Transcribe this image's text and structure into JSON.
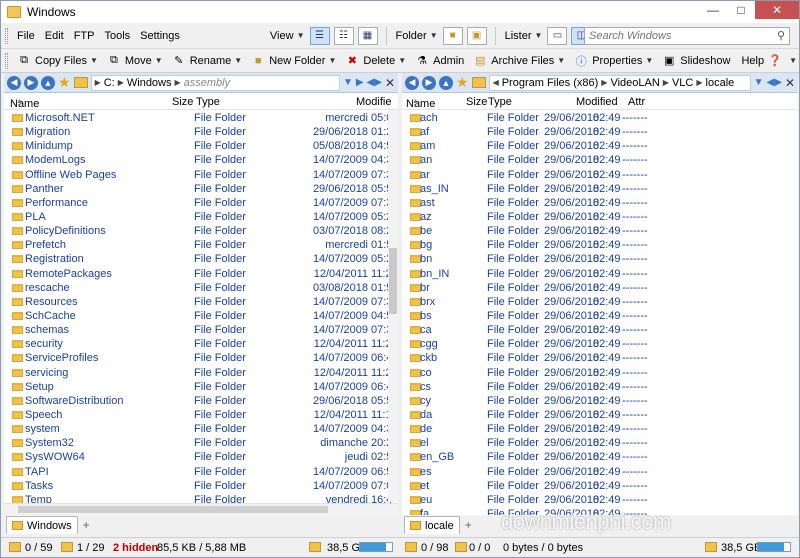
{
  "window": {
    "title": "Windows"
  },
  "menu": [
    "File",
    "Edit",
    "FTP",
    "Tools",
    "Settings"
  ],
  "view_bar": {
    "view_label": "View",
    "folder_label": "Folder",
    "lister_label": "Lister"
  },
  "search": {
    "placeholder": "Search Windows"
  },
  "toolbar": {
    "copy": "Copy Files",
    "move": "Move",
    "rename": "Rename",
    "new_folder": "New Folder",
    "delete": "Delete",
    "admin": "Admin",
    "archive": "Archive Files",
    "properties": "Properties",
    "slideshow": "Slideshow",
    "help": "Help"
  },
  "left": {
    "path": [
      "C:",
      "Windows",
      "assembly"
    ],
    "columns": {
      "name": "Name",
      "size": "Size",
      "type": "Type",
      "modified": "Modifie"
    },
    "rows": [
      {
        "name": "Microsoft.NET",
        "type": "File Folder",
        "date": "mercredi",
        "time": "05:0"
      },
      {
        "name": "Migration",
        "type": "File Folder",
        "date": "29/06/2018",
        "time": "01:2"
      },
      {
        "name": "Minidump",
        "type": "File Folder",
        "date": "05/08/2018",
        "time": "04:5"
      },
      {
        "name": "ModemLogs",
        "type": "File Folder",
        "date": "14/07/2009",
        "time": "04:3"
      },
      {
        "name": "Offline Web Pages",
        "type": "File Folder",
        "date": "14/07/2009",
        "time": "07:3"
      },
      {
        "name": "Panther",
        "type": "File Folder",
        "date": "29/06/2018",
        "time": "05:5"
      },
      {
        "name": "Performance",
        "type": "File Folder",
        "date": "14/07/2009",
        "time": "07:3"
      },
      {
        "name": "PLA",
        "type": "File Folder",
        "date": "14/07/2009",
        "time": "05:2"
      },
      {
        "name": "PolicyDefinitions",
        "type": "File Folder",
        "date": "03/07/2018",
        "time": "08:2"
      },
      {
        "name": "Prefetch",
        "type": "File Folder",
        "date": "mercredi",
        "time": "01:5"
      },
      {
        "name": "Registration",
        "type": "File Folder",
        "date": "14/07/2009",
        "time": "05:2"
      },
      {
        "name": "RemotePackages",
        "type": "File Folder",
        "date": "12/04/2011",
        "time": "11:2"
      },
      {
        "name": "rescache",
        "type": "File Folder",
        "date": "03/08/2018",
        "time": "01:5"
      },
      {
        "name": "Resources",
        "type": "File Folder",
        "date": "14/07/2009",
        "time": "07:3"
      },
      {
        "name": "SchCache",
        "type": "File Folder",
        "date": "14/07/2009",
        "time": "04:5"
      },
      {
        "name": "schemas",
        "type": "File Folder",
        "date": "14/07/2009",
        "time": "07:3"
      },
      {
        "name": "security",
        "type": "File Folder",
        "date": "12/04/2011",
        "time": "11:2"
      },
      {
        "name": "ServiceProfiles",
        "type": "File Folder",
        "date": "14/07/2009",
        "time": "06:4"
      },
      {
        "name": "servicing",
        "type": "File Folder",
        "date": "12/04/2011",
        "time": "11:2"
      },
      {
        "name": "Setup",
        "type": "File Folder",
        "date": "14/07/2009",
        "time": "06:4"
      },
      {
        "name": "SoftwareDistribution",
        "type": "File Folder",
        "date": "29/06/2018",
        "time": "05:5"
      },
      {
        "name": "Speech",
        "type": "File Folder",
        "date": "12/04/2011",
        "time": "11:1"
      },
      {
        "name": "system",
        "type": "File Folder",
        "date": "14/07/2009",
        "time": "04:3"
      },
      {
        "name": "System32",
        "type": "File Folder",
        "date": "dimanche",
        "time": "20:2"
      },
      {
        "name": "SysWOW64",
        "type": "File Folder",
        "date": "jeudi",
        "time": "02:5"
      },
      {
        "name": "TAPI",
        "type": "File Folder",
        "date": "14/07/2009",
        "time": "06:5"
      },
      {
        "name": "Tasks",
        "type": "File Folder",
        "date": "14/07/2009",
        "time": "07:0"
      },
      {
        "name": "Temp",
        "type": "File Folder",
        "date": "vendredi",
        "time": "16:4"
      }
    ],
    "tab": "Windows",
    "status": {
      "count": "0 / 59",
      "dirs": "1 / 29",
      "hidden": "2 hidden",
      "size": "85,5 KB / 5,88 MB",
      "free": "38,5 GB"
    },
    "free_fraction": 0.8
  },
  "right": {
    "path": [
      "Program Files (x86)",
      "VideoLAN",
      "VLC",
      "locale"
    ],
    "columns": {
      "name": "Name",
      "size": "Size",
      "type": "Type",
      "modified": "Modified",
      "attr": "Attr"
    },
    "rows": [
      {
        "name": "ach"
      },
      {
        "name": "af"
      },
      {
        "name": "am"
      },
      {
        "name": "an"
      },
      {
        "name": "ar"
      },
      {
        "name": "as_IN"
      },
      {
        "name": "ast"
      },
      {
        "name": "az"
      },
      {
        "name": "be"
      },
      {
        "name": "bg"
      },
      {
        "name": "bn"
      },
      {
        "name": "bn_IN"
      },
      {
        "name": "br"
      },
      {
        "name": "brx"
      },
      {
        "name": "bs"
      },
      {
        "name": "ca"
      },
      {
        "name": "cgg"
      },
      {
        "name": "ckb"
      },
      {
        "name": "co"
      },
      {
        "name": "cs"
      },
      {
        "name": "cy"
      },
      {
        "name": "da"
      },
      {
        "name": "de"
      },
      {
        "name": "el"
      },
      {
        "name": "en_GB"
      },
      {
        "name": "es"
      },
      {
        "name": "et"
      },
      {
        "name": "eu"
      },
      {
        "name": "fa"
      }
    ],
    "row_type": "File Folder",
    "row_date": "29/06/2018",
    "row_time": "02:49",
    "row_attr": "-------",
    "tab": "locale",
    "status": {
      "count": "0 / 98",
      "dirs": "0 / 0",
      "size": "0 bytes / 0 bytes",
      "free": "38,5 GB"
    },
    "free_fraction": 0.8
  },
  "watermark": "downmienphi.com"
}
